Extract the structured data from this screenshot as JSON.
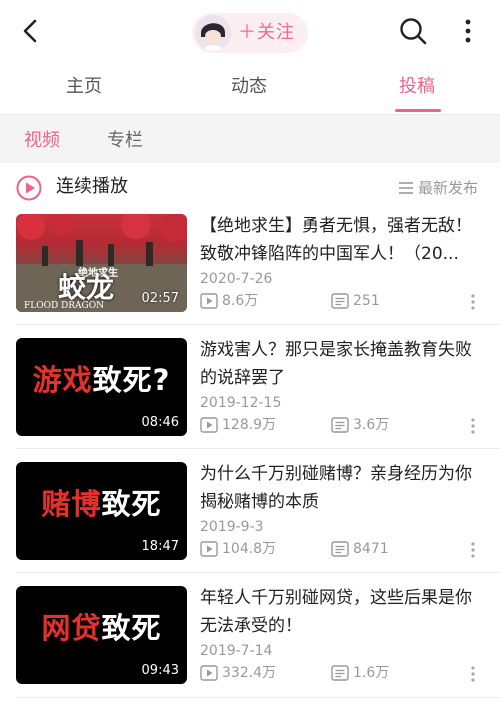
{
  "header": {
    "follow_label": "＋关注"
  },
  "main_tabs": [
    {
      "label": "主页"
    },
    {
      "label": "动态"
    },
    {
      "label": "投稿"
    }
  ],
  "sub_tabs": [
    {
      "label": "视频"
    },
    {
      "label": "专栏"
    }
  ],
  "playlist": {
    "play_label": "连续播放",
    "sort_label": "最新发布"
  },
  "colors": {
    "accent": "#f0628a",
    "follow_bg": "#fdeef2"
  },
  "videos": [
    {
      "title": "【绝地求生】勇者无惧，强者无敌！致敬冲锋陷阵的中国军人！（20...",
      "date": "2020-7-26",
      "plays": "8.6万",
      "danmaku": "251",
      "duration": "02:57",
      "thumb_text": "蛟龙",
      "thumb_small": "绝地求生",
      "thumb_sub": "FLOOD DRAGON"
    },
    {
      "title": "游戏害人？那只是家长掩盖教育失败的说辞罢了",
      "date": "2019-12-15",
      "plays": "128.9万",
      "danmaku": "3.6万",
      "duration": "08:46",
      "thumb_red": "游戏",
      "thumb_white": "致死?"
    },
    {
      "title": "为什么千万别碰赌博？亲身经历为你揭秘赌博的本质",
      "date": "2019-9-3",
      "plays": "104.8万",
      "danmaku": "8471",
      "duration": "18:47",
      "thumb_red": "赌博",
      "thumb_white": "致死"
    },
    {
      "title": "年轻人千万别碰网贷，这些后果是你无法承受的！",
      "date": "2019-7-14",
      "plays": "332.4万",
      "danmaku": "1.6万",
      "duration": "09:43",
      "thumb_red": "网贷",
      "thumb_white": "致死"
    }
  ]
}
